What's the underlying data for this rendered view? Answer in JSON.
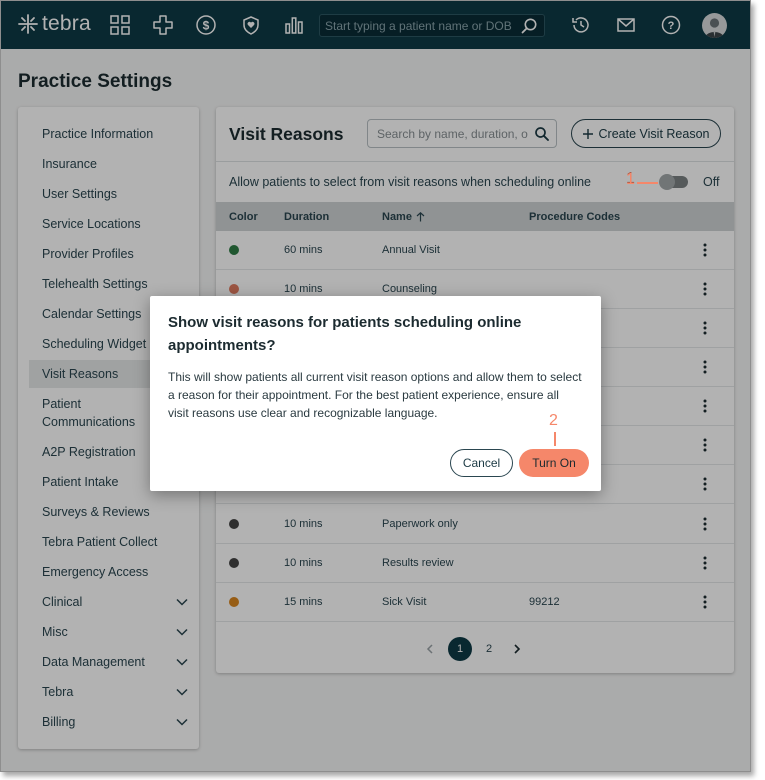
{
  "nav": {
    "logo_text": "tebra",
    "search_placeholder": "Start typing a patient name or DOB",
    "bg_color": "#0e3a45"
  },
  "page": {
    "title": "Practice Settings"
  },
  "sidebar": {
    "items": [
      {
        "label": "Practice Information"
      },
      {
        "label": "Insurance"
      },
      {
        "label": "User Settings"
      },
      {
        "label": "Service Locations"
      },
      {
        "label": "Provider Profiles"
      },
      {
        "label": "Telehealth Settings"
      },
      {
        "label": "Calendar Settings"
      },
      {
        "label": "Scheduling Widget"
      },
      {
        "label": "Visit Reasons",
        "active": true
      },
      {
        "label": "Patient Communications"
      },
      {
        "label": "A2P Registration"
      },
      {
        "label": "Patient Intake"
      },
      {
        "label": "Surveys & Reviews"
      },
      {
        "label": "Tebra Patient Collect"
      },
      {
        "label": "Emergency Access"
      },
      {
        "label": "Clinical",
        "expandable": true
      },
      {
        "label": "Misc",
        "expandable": true
      },
      {
        "label": "Data Management",
        "expandable": true
      },
      {
        "label": "Tebra",
        "expandable": true
      },
      {
        "label": "Billing",
        "expandable": true
      }
    ]
  },
  "main": {
    "title": "Visit Reasons",
    "search_placeholder": "Search by name, duration, or code",
    "create_label": "Create Visit Reason",
    "allow_text": "Allow patients to select from visit reasons when scheduling online",
    "toggle_state": "Off",
    "toggle_on": false,
    "columns": {
      "color": "Color",
      "duration": "Duration",
      "name": "Name",
      "codes": "Procedure Codes"
    },
    "rows": [
      {
        "color": "#2e7d46",
        "duration": "60 mins",
        "name": "Annual Visit",
        "codes": ""
      },
      {
        "color": "#e07a5f",
        "duration": "10 mins",
        "name": "Counseling",
        "codes": ""
      },
      {
        "color": "#555555",
        "duration": "",
        "name": "",
        "codes": ""
      },
      {
        "color": "#555555",
        "duration": "",
        "name": "",
        "codes": ""
      },
      {
        "color": "#555555",
        "duration": "",
        "name": "",
        "codes": ""
      },
      {
        "color": "#555555",
        "duration": "",
        "name": "",
        "codes": ""
      },
      {
        "color": "#555555",
        "duration": "",
        "name": "",
        "codes": ""
      },
      {
        "color": "#444444",
        "duration": "10 mins",
        "name": "Paperwork only",
        "codes": ""
      },
      {
        "color": "#444444",
        "duration": "10 mins",
        "name": "Results review",
        "codes": ""
      },
      {
        "color": "#d8861f",
        "duration": "15 mins",
        "name": "Sick Visit",
        "codes": "99212"
      }
    ],
    "pages": [
      "1",
      "2"
    ],
    "current_page": "1"
  },
  "callouts": {
    "one": "1",
    "two": "2",
    "color": "#f5876a"
  },
  "modal": {
    "title": "Show visit reasons for patients scheduling online appointments?",
    "body": "This will show patients all current visit reason options and allow them to select a reason for their appointment. For the best patient experience, ensure all visit reasons use clear and recognizable language.",
    "cancel_label": "Cancel",
    "confirm_label": "Turn On"
  }
}
